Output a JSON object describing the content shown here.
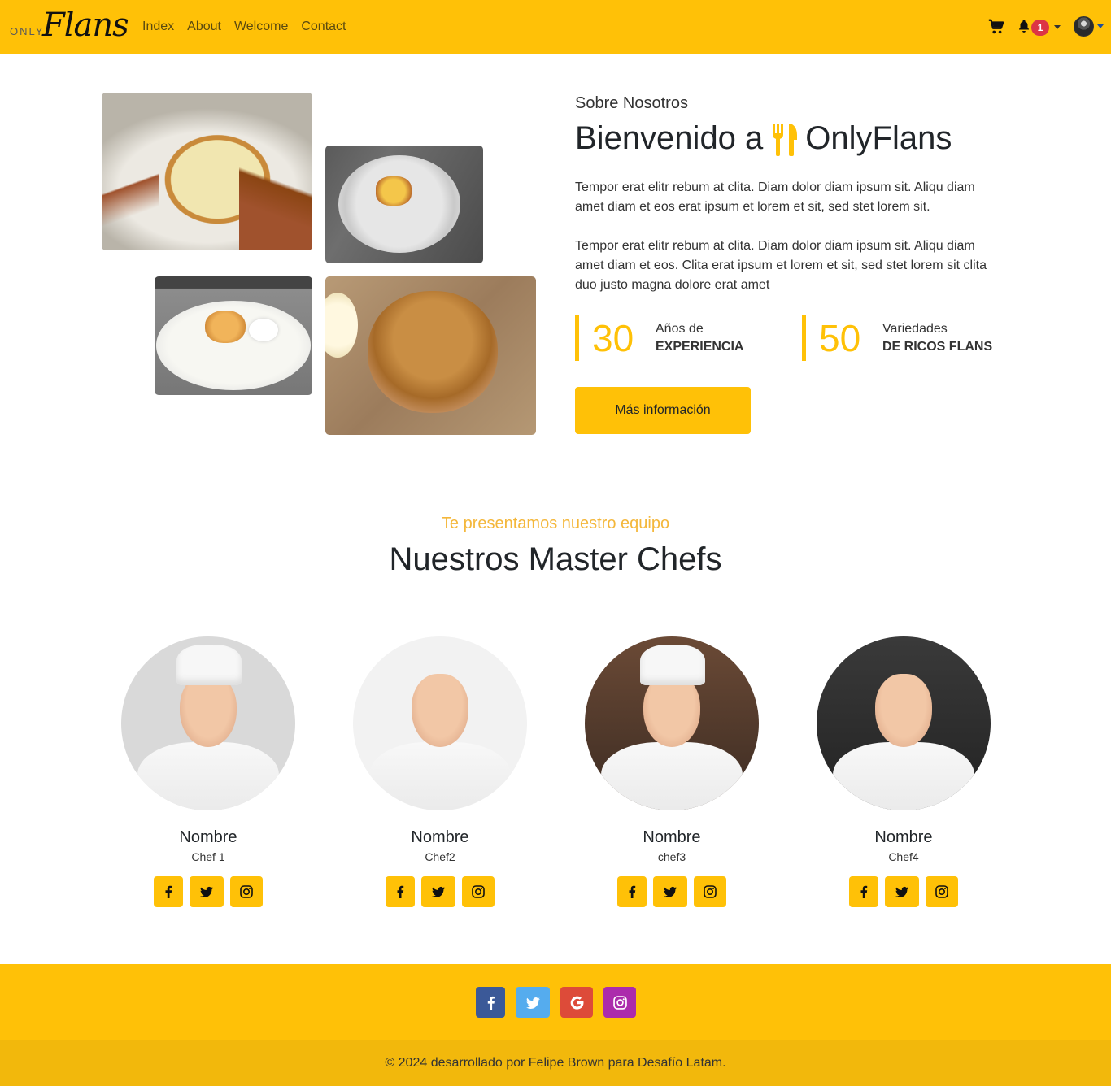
{
  "colors": {
    "accent": "#FFC107",
    "accent_dark": "#F2B80C",
    "badge": "#dc3545",
    "facebook": "#3B5998",
    "twitter": "#55ACEE",
    "google": "#DD4B39",
    "instagram": "#AC2BAC"
  },
  "navbar": {
    "brand_small": "ONLY",
    "brand_script": "Flans",
    "links": [
      "Index",
      "About",
      "Welcome",
      "Contact"
    ],
    "notification_count": "1",
    "icons": [
      "cart-icon",
      "bell-icon",
      "avatar"
    ]
  },
  "about": {
    "images": [
      "flan-photo-1",
      "flan-photo-2",
      "flan-photo-3",
      "flan-photo-4"
    ],
    "subtitle": "Sobre Nosotros",
    "title_prefix": "Bienvenido a",
    "title_icon": "utensils-icon",
    "title_brand": "OnlyFlans",
    "paragraph_1": "Tempor erat elitr rebum at clita. Diam dolor diam ipsum sit. Aliqu diam amet diam et eos erat ipsum et lorem et sit, sed stet lorem sit.",
    "paragraph_2": "Tempor erat elitr rebum at clita. Diam dolor diam ipsum sit. Aliqu diam amet diam et eos. Clita erat ipsum et lorem et sit, sed stet lorem sit clita duo justo magna dolore erat amet",
    "stats": [
      {
        "number": "30",
        "label": "Años de",
        "bold": "Experiencia"
      },
      {
        "number": "50",
        "label": "Variedades",
        "bold": "De ricos flans"
      }
    ],
    "button": "Más información"
  },
  "team": {
    "subtitle": "Te presentamos nuestro equipo",
    "title": "Nuestros Master Chefs",
    "chefs": [
      {
        "name": "Nombre",
        "role": "Chef 1"
      },
      {
        "name": "Nombre",
        "role": "Chef2"
      },
      {
        "name": "Nombre",
        "role": "chef3"
      },
      {
        "name": "Nombre",
        "role": "Chef4"
      }
    ]
  },
  "footer": {
    "social_icons": [
      "facebook-icon",
      "twitter-icon",
      "google-icon",
      "instagram-icon"
    ],
    "copyright": "© 2024 desarrollado por Felipe Brown para Desafío Latam."
  }
}
